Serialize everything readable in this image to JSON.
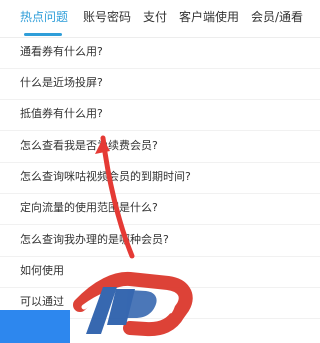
{
  "tabs": [
    {
      "label": "热点问题"
    },
    {
      "label": "账号密码"
    },
    {
      "label": "支付"
    },
    {
      "label": "客户端使用"
    },
    {
      "label": "会员/通看"
    }
  ],
  "faq": [
    {
      "label": "通看券有什么用?"
    },
    {
      "label": "什么是近场投屏?"
    },
    {
      "label": "抵值券有什么用?"
    },
    {
      "label": "怎么查看我是否为续费会员?"
    },
    {
      "label": "怎么查询咪咕视频会员的到期时间?"
    },
    {
      "label": "定向流量的使用范围是什么?"
    },
    {
      "label": "怎么查询我办理的是哪种会员?"
    },
    {
      "label": "如何使用"
    },
    {
      "label": "可以通过"
    }
  ],
  "colors": {
    "accent": "#2f9ed9",
    "arrow": "#e53a35",
    "watermark_red": "#dc3b2f",
    "watermark_blue": "#2f62ad"
  }
}
